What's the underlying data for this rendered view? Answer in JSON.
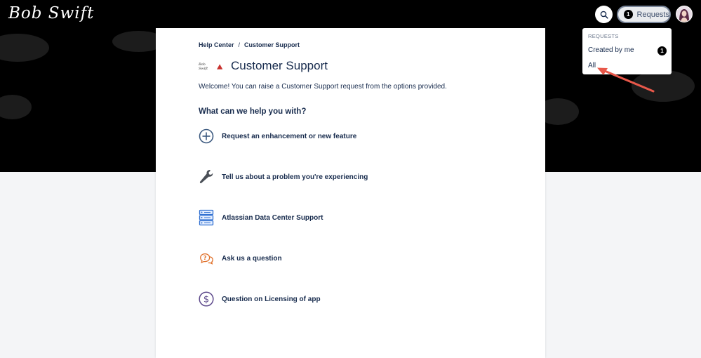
{
  "header": {
    "logo_text": "Bob Swift",
    "search_icon": "search-icon",
    "requests_button": {
      "badge": "1",
      "label": "Requests"
    },
    "avatar_icon": "user-avatar"
  },
  "breadcrumb": {
    "home": "Help Center",
    "separator": "/",
    "current": "Customer Support"
  },
  "portal": {
    "title": "Customer Support",
    "welcome": "Welcome! You can raise a Customer Support request from the options provided.",
    "help_heading": "What can we help you with?"
  },
  "request_types": [
    {
      "label": "Request an enhancement or new feature",
      "icon": "plus-circle-icon"
    },
    {
      "label": "Tell us about a problem you're experiencing",
      "icon": "wrench-icon"
    },
    {
      "label": "Atlassian Data Center Support",
      "icon": "server-icon"
    },
    {
      "label": "Ask us a question",
      "icon": "question-bubble-icon"
    },
    {
      "label": "Question on Licensing of app",
      "icon": "dollar-circle-icon"
    }
  ],
  "requests_dropdown": {
    "heading": "REQUESTS",
    "items": [
      {
        "label": "Created by me",
        "badge": "1"
      },
      {
        "label": "All"
      }
    ]
  },
  "colors": {
    "hero_bg": "#000000",
    "page_bg": "#f4f5f7",
    "text_primary": "#172b4d",
    "annotation_arrow": "#e8584a",
    "server_icon": "#2f6fd1",
    "question_icon": "#e0702a",
    "dollar_icon": "#5e4a8c"
  }
}
